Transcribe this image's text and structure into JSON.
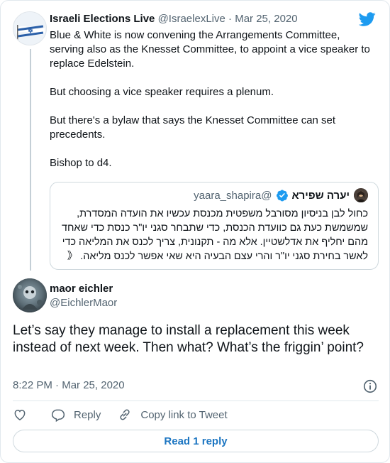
{
  "parent_tweet": {
    "author_name": "Israeli Elections Live",
    "handle": "@IsraelexLive",
    "separator": "·",
    "date": "Mar 25, 2020",
    "paragraphs": [
      "Blue & White is now convening the Arrangements Committee, serving also as the Knesset Committee, to appoint a vice speaker to replace Edelstein.",
      "But choosing a vice speaker requires a plenum.",
      "But there's a bylaw that says the Knesset Committee can set precedents.",
      "Bishop to d4."
    ],
    "icons": {
      "avatar": "israel-flag-avatar",
      "logo": "twitter-bird-icon"
    }
  },
  "quoted_tweet": {
    "author_name": "יערה שפירא",
    "handle": "@yaara_shapira",
    "text": "כחול לבן בניסיון מסורבל משפטית מכנסת עכשיו את הועדה המסדרת, שמשמשת כעת גם כוועדת הכנסת, כדי שתבחר סגני יו\"ר כנסת כדי שאחד מהם יחליף את אדלשטיין. אלא מה - תקנונית, צריך לכנס את המליאה כדי לאשר בחירת סגני יו\"ר והרי עצם הבעיה היא שאי אפשר לכנס מליאה. 《",
    "icons": {
      "verified": "verified-badge-icon"
    }
  },
  "reply_tweet": {
    "author_name": "maor eichler",
    "handle": "@EichlerMaor",
    "text": "Let’s say they manage to install a replacement this week instead of next week. Then what? What’s the friggin’ point?",
    "time": "8:22 PM",
    "separator": "·",
    "date": "Mar 25, 2020"
  },
  "actions": {
    "like_icon": "heart-icon",
    "reply_label": "Reply",
    "copy_label": "Copy link to Tweet",
    "read_replies_label": "Read 1 reply"
  },
  "colors": {
    "accent": "#1d9bf0",
    "link_button_text": "#1d76c2",
    "muted_text": "#536471",
    "border": "#cfd9de"
  }
}
